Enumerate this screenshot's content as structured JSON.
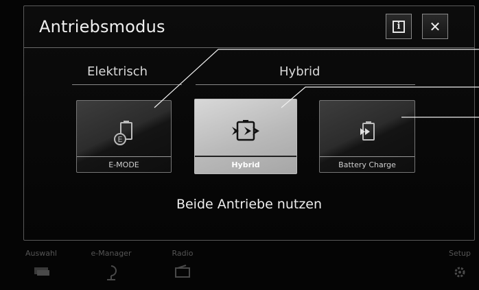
{
  "dialog": {
    "title": "Antriebsmodus",
    "info_label": "i",
    "close_label": "✕"
  },
  "groups": {
    "electric_label": "Elektrisch",
    "hybrid_label": "Hybrid"
  },
  "modes": [
    {
      "label": "E-MODE",
      "icon": "e-mode-battery-icon",
      "selected": false
    },
    {
      "label": "Hybrid",
      "icon": "hybrid-mode-icon",
      "selected": true
    },
    {
      "label": "Battery Charge",
      "icon": "battery-charge-icon",
      "selected": false
    }
  ],
  "status_text": "Beide Antriebe nutzen",
  "nav": [
    {
      "label": "Auswahl",
      "icon": "cars-icon"
    },
    {
      "label": "e-Manager",
      "icon": "charging-plug-icon"
    },
    {
      "label": "Radio",
      "icon": "radio-icon"
    },
    {
      "label": "Setup",
      "icon": "settings-gear-icon"
    }
  ],
  "colors": {
    "background": "#050505",
    "selected_tile": "#c0c0c0",
    "text": "#e8e8e8"
  }
}
